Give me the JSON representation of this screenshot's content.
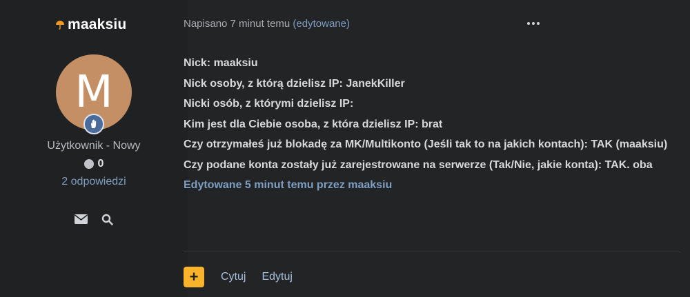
{
  "author": {
    "username": "maaksiu",
    "avatar_letter": "M",
    "avatar_color": "#c48f64",
    "rank_badge_icon": "hand-icon",
    "rank_title": "Użytkownik - Nowy",
    "reputation": "0",
    "replies": "2 odpowiedzi",
    "action_icons": [
      "envelope-icon",
      "search-icon"
    ]
  },
  "post": {
    "meta_text": "Napisano 7 minut temu",
    "meta_edited": "(edytowane)",
    "more_icon": "ellipsis-icon",
    "lines": [
      "Nick: maaksiu",
      "Nick osoby, z którą dzielisz IP: JanekKiller",
      "Nicki osób, z którymi dzielisz IP:",
      "Kim jest dla Ciebie osoba, z która dzielisz IP: brat",
      "Czy otrzymałeś już blokadę za MK/Multikonto (Jeśli tak to na jakich kontach): TAK (maaksiu)",
      "Czy podane konta zostały już zarejestrowane na serwerze (Tak/Nie, jakie konta): TAK. oba"
    ],
    "edit_note": "Edytowane 5 minut temu przez maaksiu"
  },
  "actions": {
    "plus_label": "+",
    "quote_label": "Cytuj",
    "edit_label": "Edytuj"
  },
  "colors": {
    "accent": "#f8b22b",
    "link": "#7e9ec2",
    "background": "#222426"
  }
}
